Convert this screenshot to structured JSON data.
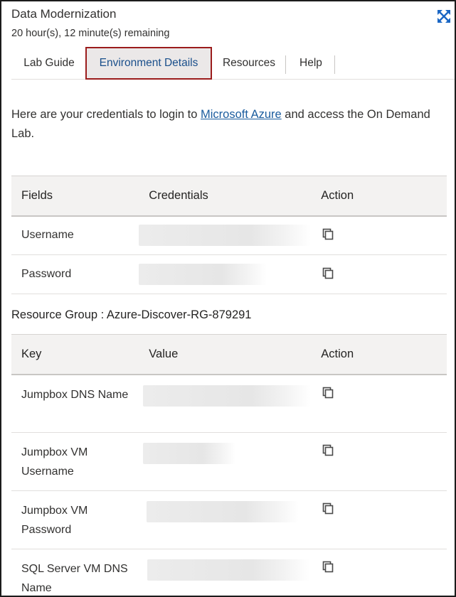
{
  "app": {
    "title": "Data Modernization",
    "remaining": "20 hour(s), 12 minute(s) remaining",
    "expand_icon": "expand-arrows-icon",
    "accent_color": "#1a5c9e"
  },
  "tabs": [
    {
      "label": "Lab Guide",
      "active": false
    },
    {
      "label": "Environment Details",
      "active": true
    },
    {
      "label": "Resources",
      "active": false
    },
    {
      "label": "Help",
      "active": false
    }
  ],
  "intro": {
    "before": "Here are your credentials to login to ",
    "link": "Microsoft Azure",
    "after": " and access the On Demand Lab."
  },
  "credentials_table": {
    "headers": [
      "Fields",
      "Credentials",
      "Action"
    ],
    "rows": [
      {
        "field": "Username",
        "value_hidden": true,
        "action_icon": "copy-icon"
      },
      {
        "field": "Password",
        "value_hidden": true,
        "action_icon": "copy-icon"
      }
    ]
  },
  "resource_group": {
    "label": "Resource Group : Azure-Discover-RG-879291"
  },
  "resources_table": {
    "headers": [
      "Key",
      "Value",
      "Action"
    ],
    "rows": [
      {
        "key": "Jumpbox DNS Name",
        "value_hidden": true,
        "action_icon": "copy-icon"
      },
      {
        "key": "Jumpbox VM Username",
        "value_hidden": true,
        "action_icon": "copy-icon"
      },
      {
        "key": "Jumpbox VM Password",
        "value_hidden": true,
        "action_icon": "copy-icon"
      },
      {
        "key": "SQL Server VM DNS Name",
        "value_hidden": true,
        "action_icon": "copy-icon"
      }
    ]
  }
}
